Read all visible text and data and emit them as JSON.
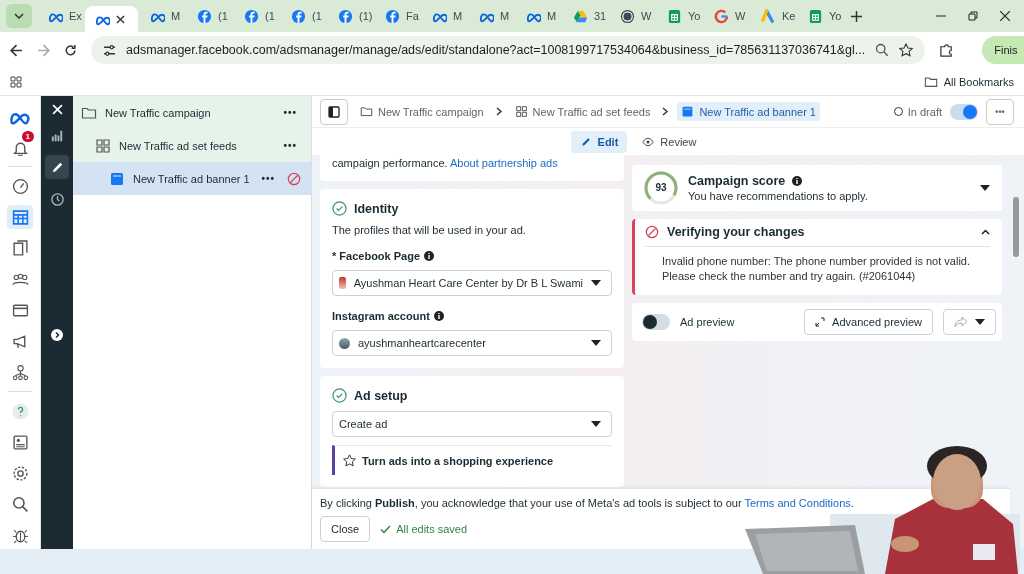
{
  "browser": {
    "tabs": [
      {
        "kind": "meta",
        "label": "Ex",
        "selected": false
      },
      {
        "kind": "meta",
        "selected": true
      },
      {
        "kind": "meta",
        "label": "M",
        "selected": false
      },
      {
        "kind": "facebook",
        "label": "(1",
        "selected": false
      },
      {
        "kind": "facebook",
        "label": "(1",
        "selected": false
      },
      {
        "kind": "facebook",
        "label": "(1",
        "selected": false
      },
      {
        "kind": "facebook",
        "label": "(1)",
        "selected": false
      },
      {
        "kind": "facebook",
        "label": "Fa",
        "selected": false
      },
      {
        "kind": "meta",
        "label": "M",
        "selected": false
      },
      {
        "kind": "meta",
        "label": "M",
        "selected": false
      },
      {
        "kind": "meta",
        "label": "M",
        "selected": false
      },
      {
        "kind": "drive",
        "label": "31",
        "selected": false
      },
      {
        "kind": "wordpress",
        "label": "W",
        "selected": false
      },
      {
        "kind": "sheets",
        "label": "Yo",
        "selected": false
      },
      {
        "kind": "google",
        "label": "W",
        "selected": false
      },
      {
        "kind": "ads",
        "label": "Ke",
        "selected": false
      },
      {
        "kind": "sheets",
        "label": "Yo",
        "selected": false
      }
    ],
    "address": "adsmanager.facebook.com/adsmanager/manage/ads/edit/standalone?act=1008199717534064&business_id=785631137036741&gl...",
    "profile_button": "Finis",
    "bookmarks": "All Bookmarks"
  },
  "nav": [
    {
      "kind": "bell",
      "badge": "1",
      "selected": false
    },
    {
      "kind": "gauge",
      "selected": false
    },
    {
      "kind": "table",
      "selected": true
    },
    {
      "kind": "pages",
      "selected": false
    },
    {
      "kind": "people",
      "selected": false
    },
    {
      "kind": "card",
      "selected": false
    },
    {
      "kind": "megaphone",
      "selected": false
    },
    {
      "kind": "network",
      "selected": false
    },
    {
      "kind": "help",
      "selected": false
    },
    {
      "kind": "contact",
      "selected": false
    },
    {
      "kind": "gear",
      "selected": false
    },
    {
      "kind": "search",
      "selected": false
    },
    {
      "kind": "bug",
      "selected": false
    }
  ],
  "tool_rail": [
    {
      "kind": "chart",
      "selected": false
    },
    {
      "kind": "pencil",
      "selected": true
    },
    {
      "kind": "clock",
      "selected": false
    }
  ],
  "tree": [
    {
      "kind": "folder",
      "label": "New Traffic campaign",
      "more": "•••",
      "selected": false,
      "children": [
        {
          "kind": "adset",
          "label": "New Traffic ad set feeds",
          "more": "•••",
          "selected": false,
          "children": [
            {
              "kind": "ad",
              "label": "New Traffic ad banner 1",
              "more": "•••",
              "selected": true,
              "error": true
            }
          ]
        }
      ]
    }
  ],
  "breadcrumb": [
    {
      "kind": "folder",
      "label": "New Traffic campaign",
      "selected": false
    },
    {
      "kind": "adset",
      "label": "New Traffic ad set feeds",
      "selected": false
    },
    {
      "kind": "ad",
      "label": "New Traffic ad banner 1",
      "selected": true
    }
  ],
  "status": "In draft",
  "status_toggle_on": true,
  "more_button": "•••",
  "mode_tabs": [
    {
      "kind": "pencil",
      "label": "Edit",
      "selected": true
    },
    {
      "kind": "eye",
      "label": "Review",
      "selected": false
    }
  ],
  "partnership": {
    "text": "campaign performance. ",
    "link": "About partnership ads"
  },
  "identity": {
    "title": "Identity",
    "description": "The profiles that will be used in your ad.",
    "fields": [
      {
        "label": "* Facebook Page",
        "value": "Ayushman Heart Care Center by Dr B L Swami"
      },
      {
        "label": "Instagram account",
        "value": "ayushmanheartcarecenter"
      }
    ]
  },
  "ad_setup": {
    "title": "Ad setup",
    "select": "Create ad",
    "callout": "Turn ads into a shopping experience"
  },
  "campaign_score": {
    "score": "93",
    "title": "Campaign score",
    "subtitle": "You have recommendations to apply."
  },
  "verification": {
    "title": "Verifying your changes",
    "expanded": true,
    "message": "Invalid phone number: The phone number provided is not valid. Please check the number and try again. (#2061044)"
  },
  "preview": {
    "label": "Ad preview",
    "on": false,
    "button": "Advanced preview"
  },
  "footer": {
    "notice": "By clicking **Publish**, you acknowledge that your use of Meta's ad tools is subject to our ",
    "link": "Terms and Conditions",
    "end": ".",
    "close": "Close",
    "saved": "All edits saved"
  }
}
